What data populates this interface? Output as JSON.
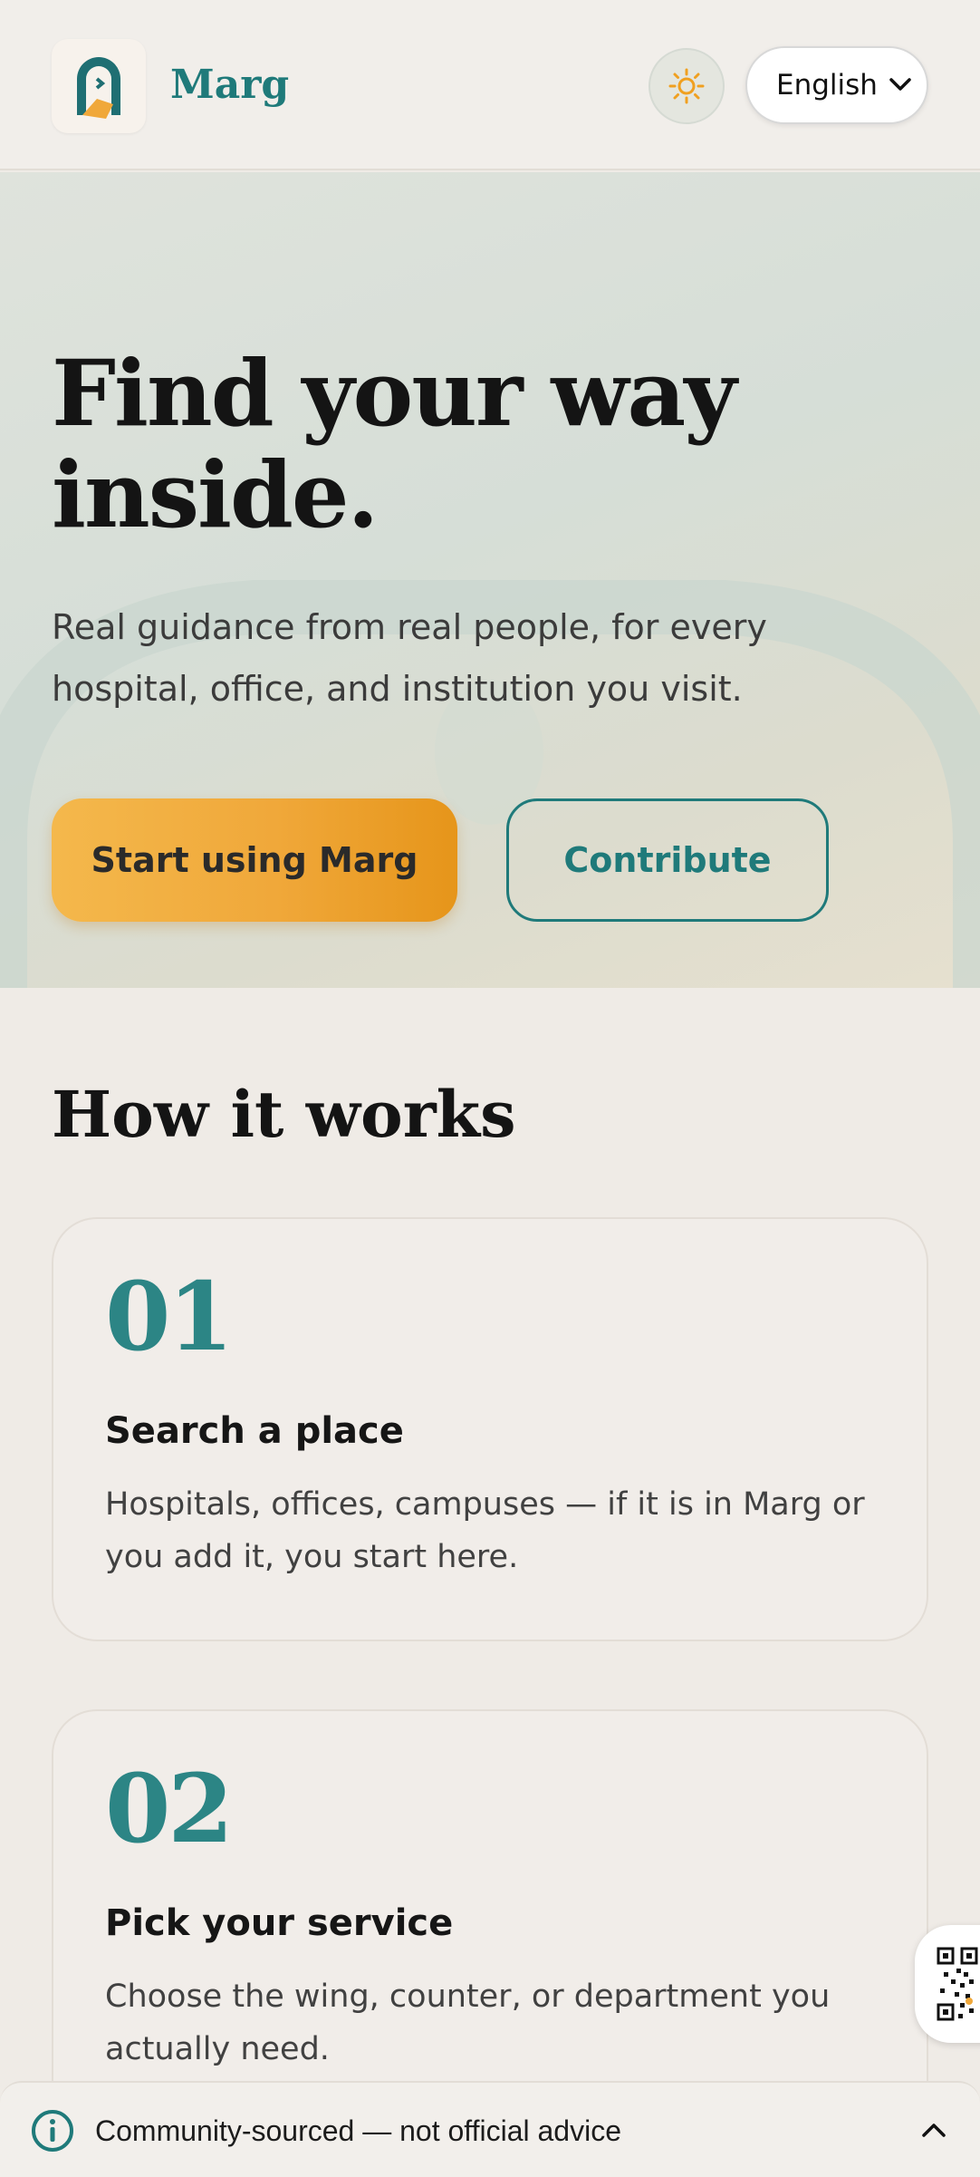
{
  "header": {
    "logo_icon": "marg-logo-icon",
    "brand": "Marg",
    "theme_icon": "sun-icon",
    "language": "English",
    "language_icon": "chevron-down-icon"
  },
  "hero": {
    "title": "Find your way inside.",
    "subtitle": "Real guidance from real people, for every hospital, office, and institution you visit.",
    "primary_label": "Start using Marg",
    "secondary_label": "Contribute"
  },
  "how": {
    "title": "How it works",
    "steps": [
      {
        "num": "01",
        "title": "Search a place",
        "desc": "Hospitals, offices, campuses — if it is in Marg or you add it, you start here."
      },
      {
        "num": "02",
        "title": "Pick your service",
        "desc": "Choose the wing, counter, or department you actually need."
      }
    ]
  },
  "floating": {
    "qr_icon": "qr-code-icon"
  },
  "footer": {
    "info_icon": "info-icon",
    "text": "Community-sourced — not official advice",
    "toggle_icon": "chevron-up-icon"
  },
  "colors": {
    "accent_teal": "#1f7a7a",
    "accent_amber": "#f0a83a",
    "background": "#efebe6"
  }
}
